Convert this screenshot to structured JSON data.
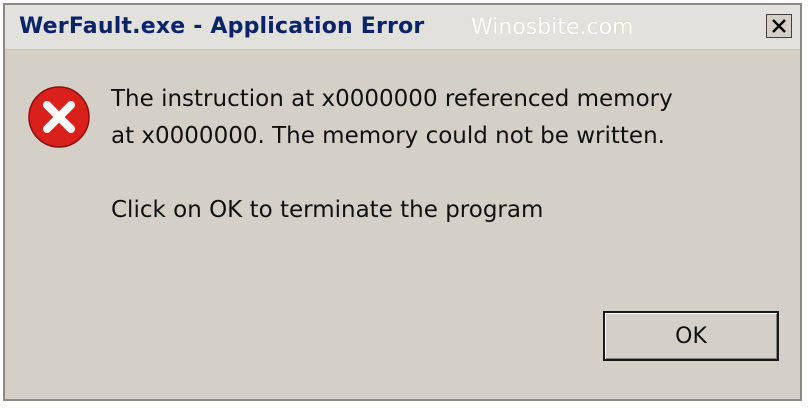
{
  "window": {
    "title": "WerFault.exe - Application Error",
    "watermark": "Winosbite.com",
    "close_glyph": "x-icon"
  },
  "dialog": {
    "icon": "error-icon",
    "message_line1": "The instruction at x0000000 referenced memory",
    "message_line2": "at x0000000. The memory could not be written.",
    "instruction": "Click on OK to terminate the program",
    "ok_label": "OK"
  },
  "colors": {
    "title_text": "#0a246a",
    "dialog_bg": "#d4d0c8",
    "error_red": "#d9201b"
  }
}
